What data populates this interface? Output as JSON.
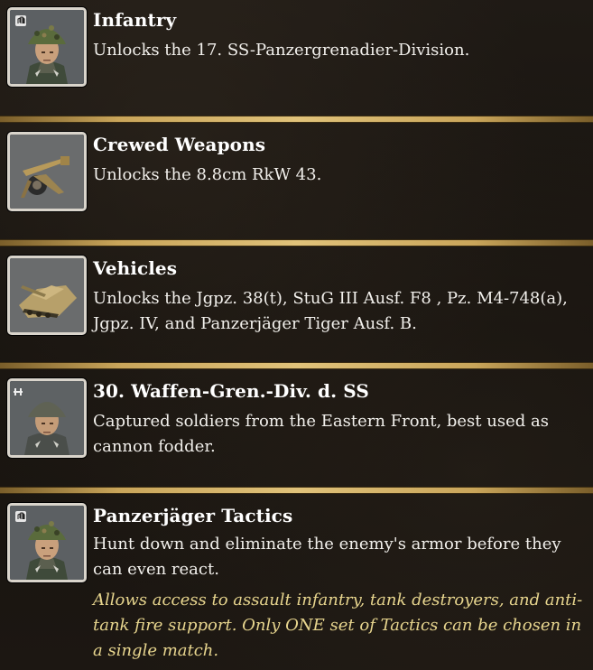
{
  "entries": [
    {
      "title": "Infantry",
      "description": "Unlocks the 17. SS-Panzergrenadier-Division.",
      "icon": "soldier-portrait-icon"
    },
    {
      "title": "Crewed Weapons",
      "description": "Unlocks the 8.8cm RkW 43.",
      "icon": "anti-tank-gun-icon"
    },
    {
      "title": "Vehicles",
      "description": "Unlocks the Jgpz. 38(t), StuG III Ausf. F8 , Pz. M4-748(a), Jgpz. IV, and Panzerjäger Tiger Ausf. B.",
      "icon": "tank-destroyer-icon"
    },
    {
      "title": "30. Waffen-Gren.-Div. d. SS",
      "description": "Captured soldiers from the Eastern Front, best used as cannon fodder.",
      "icon": "conscript-soldier-icon"
    },
    {
      "title": "Panzerjäger Tactics",
      "description": "Hunt down and eliminate the enemy's armor before they can even react.",
      "note": "Allows access to assault infantry, tank destroyers, and anti-tank fire support. Only ONE set of Tactics can be chosen in a single match.",
      "icon": "soldier-portrait-icon"
    }
  ],
  "colors": {
    "title": "#ffffff",
    "description": "#f2f0ec",
    "note": "#e7d58e",
    "divider": "#c9a55a"
  }
}
